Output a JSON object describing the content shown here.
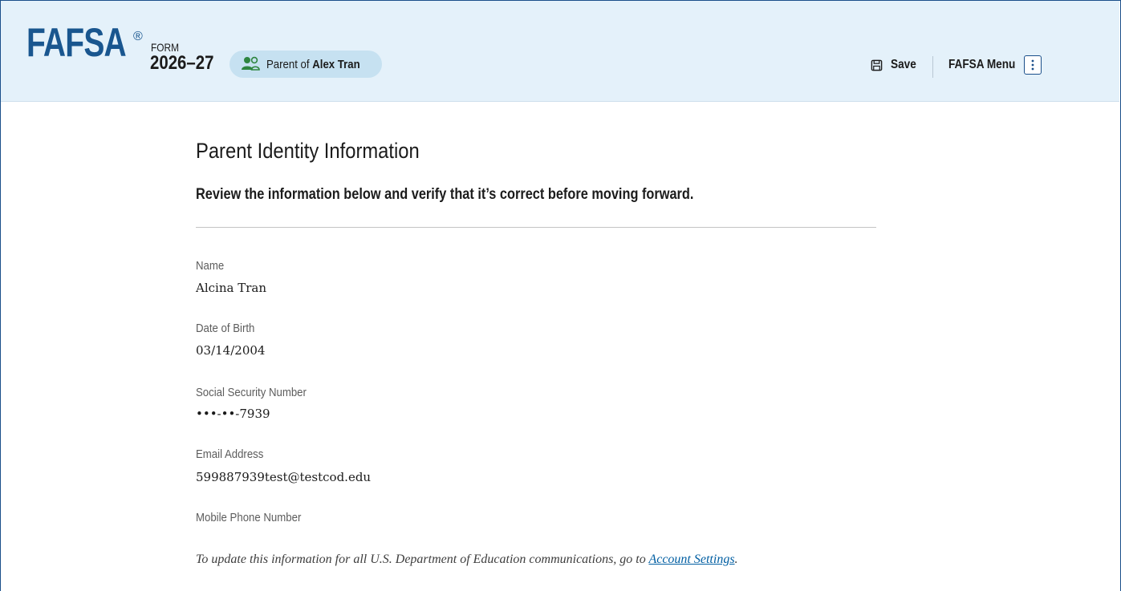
{
  "header": {
    "logo": "FAFSA",
    "registered_mark": "®",
    "form_label": "FORM",
    "form_year": "2026–27",
    "role_prefix": "Parent of ",
    "role_student": "Alex Tran",
    "role_icon": "users-icon",
    "save_label": "Save",
    "save_icon": "floppy-disk-icon",
    "menu_label": "FAFSA Menu",
    "menu_icon": "vertical-ellipsis-icon"
  },
  "main": {
    "title": "Parent Identity Information",
    "subtitle": "Review the information below and verify that it’s correct before moving forward.",
    "fields": [
      {
        "label": "Name",
        "value": "Alcina Tran"
      },
      {
        "label": "Date of Birth",
        "value": "03/14/2004"
      },
      {
        "label": "Social Security Number",
        "value": "•••-••-7939"
      },
      {
        "label": "Email Address",
        "value": "599887939test@testcod.edu"
      },
      {
        "label": "Mobile Phone Number",
        "value": ""
      }
    ],
    "note_text": "To update this information for all U.S. Department of Education communications, go to ",
    "note_link": "Account Settings",
    "note_end": "."
  },
  "colors": {
    "header_bg": "#e4f1fa",
    "brand_blue": "#19568f",
    "pill_bg": "#c6e1f1",
    "icon_green": "#2e8540",
    "link": "#005ea2"
  }
}
